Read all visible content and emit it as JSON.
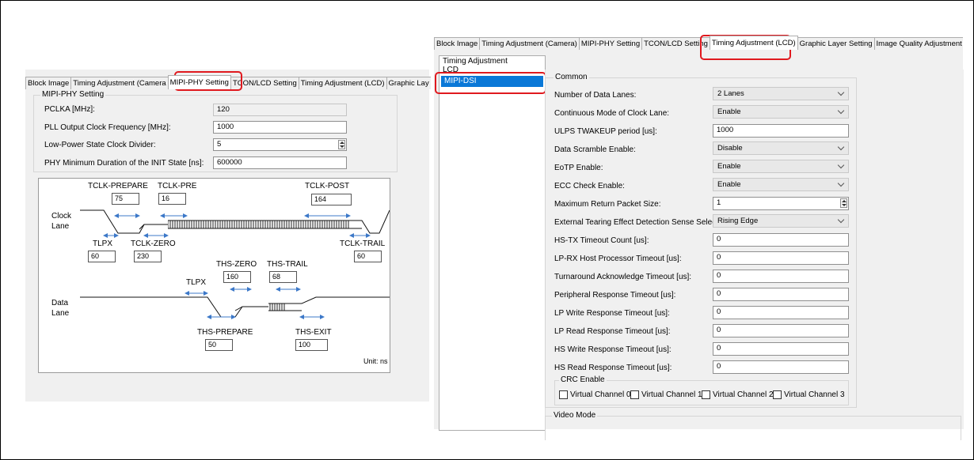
{
  "left_window": {
    "tabs": [
      "Block Image",
      "Timing Adjustment (Camera",
      "MIPI-PHY Setting",
      "TCON/LCD Setting",
      "Timing Adjustment (LCD)",
      "Graphic Lay"
    ],
    "group_title": "MIPI-PHY Setting",
    "fields": [
      {
        "label": "PCLKA [MHz]:",
        "value": "120"
      },
      {
        "label": "PLL Output Clock Frequency [MHz]:",
        "value": "1000"
      },
      {
        "label": "Low-Power State Clock Divider:",
        "value": "5"
      },
      {
        "label": "PHY Minimum Duration of the INIT State [ns]:",
        "value": "600000"
      }
    ],
    "diagram": {
      "clock_lane_label_1": "Clock",
      "clock_lane_label_2": "Lane",
      "data_lane_label_1": "Data",
      "data_lane_label_2": "Lane",
      "tclk_prepare_label": "TCLK-PREPARE",
      "tclk_prepare_value": "75",
      "tclk_pre_label": "TCLK-PRE",
      "tclk_pre_value": "16",
      "tclk_post_label": "TCLK-POST",
      "tclk_post_value": "164",
      "tlpx_clock_label": "TLPX",
      "tlpx_clock_value": "60",
      "tclk_zero_label": "TCLK-ZERO",
      "tclk_zero_value": "230",
      "tclk_trail_label": "TCLK-TRAIL",
      "tclk_trail_value": "60",
      "ths_zero_label": "THS-ZERO",
      "ths_zero_value": "160",
      "ths_trail_label": "THS-TRAIL",
      "ths_trail_value": "68",
      "tlpx_data_label": "TLPX",
      "ths_prepare_label": "THS-PREPARE",
      "ths_prepare_value": "50",
      "ths_exit_label": "THS-EXIT",
      "ths_exit_value": "100",
      "unit": "Unit: ns"
    }
  },
  "right_window": {
    "tabs": [
      "Block Image",
      "Timing Adjustment (Camera)",
      "MIPI-PHY Setting",
      "TCON/LCD Setting",
      "Timing Adjustment (LCD)",
      "Graphic Layer Setting",
      "Image Quality Adjustment"
    ],
    "tree": {
      "root": "Timing Adjustment",
      "child": "LCD",
      "selected": "MIPI-DSI"
    },
    "common_title": "Common",
    "settings": [
      {
        "label": "Number of Data Lanes:",
        "value": "2 Lanes",
        "kind": "combo"
      },
      {
        "label": "Continuous Mode of Clock Lane:",
        "value": "Enable",
        "kind": "combo"
      },
      {
        "label": "ULPS TWAKEUP period [us]:",
        "value": "1000",
        "kind": "text"
      },
      {
        "label": "Data Scramble Enable:",
        "value": "Disable",
        "kind": "combo"
      },
      {
        "label": "EoTP Enable:",
        "value": "Enable",
        "kind": "combo"
      },
      {
        "label": "ECC Check Enable:",
        "value": "Enable",
        "kind": "combo"
      },
      {
        "label": "Maximum Return Packet Size:",
        "value": "1",
        "kind": "spin"
      },
      {
        "label": "External Tearing Effect Detection Sense Select:",
        "value": "Rising Edge",
        "kind": "combo"
      },
      {
        "label": "HS-TX Timeout Count [us]:",
        "value": "0",
        "kind": "text"
      },
      {
        "label": "LP-RX Host Processor Timeout [us]:",
        "value": "0",
        "kind": "text"
      },
      {
        "label": "Turnaround Acknowledge Timeout [us]:",
        "value": "0",
        "kind": "text"
      },
      {
        "label": "Peripheral Response Timeout [us]:",
        "value": "0",
        "kind": "text"
      },
      {
        "label": "LP Write Response Timeout [us]:",
        "value": "0",
        "kind": "text"
      },
      {
        "label": "LP Read Response Timeout [us]:",
        "value": "0",
        "kind": "text"
      },
      {
        "label": "HS Write Response Timeout [us]:",
        "value": "0",
        "kind": "text"
      },
      {
        "label": "HS Read Response Timeout [us]:",
        "value": "0",
        "kind": "text"
      }
    ],
    "crc_title": "CRC Enable",
    "crc_channels": [
      "Virtual Channel 0",
      "Virtual Channel 1",
      "Virtual Channel 2",
      "Virtual Channel 3"
    ],
    "video_mode_title": "Video Mode"
  },
  "colors": {
    "highlight": "#e0191e",
    "selection": "#0a78d7",
    "arrow": "#3c78c8"
  }
}
